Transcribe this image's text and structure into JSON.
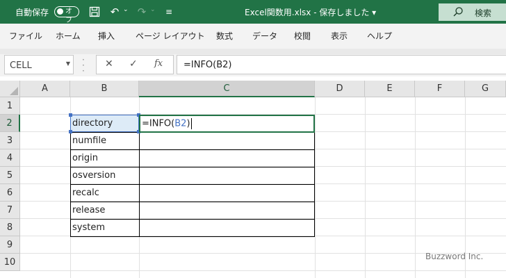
{
  "titlebar": {
    "autosave_label": "自動保存",
    "autosave_state": "オフ",
    "doc_title": "Excel関数用.xlsx - 保存しました ▾",
    "search_label": "検索",
    "accent": "#217346"
  },
  "menu": {
    "items": [
      "ファイル",
      "ホーム",
      "挿入",
      "ページ レイアウト",
      "数式",
      "データ",
      "校閲",
      "表示",
      "ヘルプ"
    ]
  },
  "formula_bar": {
    "name_box": "CELL",
    "formula": "=INFO(B2)"
  },
  "sheet": {
    "columns": [
      "A",
      "B",
      "C",
      "D",
      "E",
      "F",
      "G"
    ],
    "rows": [
      "1",
      "2",
      "3",
      "4",
      "5",
      "6",
      "7",
      "8",
      "9",
      "10"
    ],
    "b_values": [
      "directory",
      "numfile",
      "origin",
      "osversion",
      "recalc",
      "release",
      "system"
    ],
    "editing_cell": {
      "prefix": "=INFO(",
      "ref": "B2",
      "suffix": ")"
    }
  },
  "watermark": "Buzzword Inc."
}
